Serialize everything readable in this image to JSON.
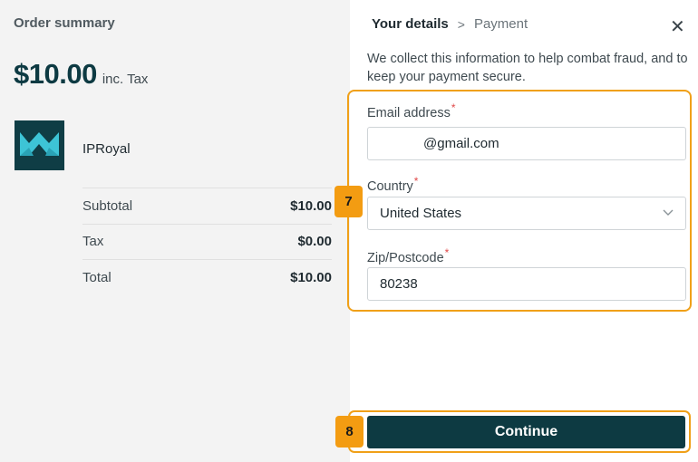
{
  "order": {
    "title": "Order summary",
    "price": "$10.00",
    "tax_note": "inc. Tax",
    "product_name": "IPRoyal",
    "logo_icon": "iproyal-crown-logo",
    "rows": [
      {
        "label": "Subtotal",
        "value": "$10.00"
      },
      {
        "label": "Tax",
        "value": "$0.00"
      },
      {
        "label": "Total",
        "value": "$10.00"
      }
    ]
  },
  "steps": {
    "current": "Your details",
    "separator": ">",
    "next": "Payment"
  },
  "close_icon": "close-icon",
  "info_text": "We collect this information to help combat fraud, and to keep your payment secure.",
  "form": {
    "email_label": "Email address",
    "email_value": "@gmail.com",
    "country_label": "Country",
    "country_value": "United States",
    "zip_label": "Zip/Postcode",
    "zip_value": "80238",
    "required_mark": "*"
  },
  "continue_label": "Continue",
  "annotations": {
    "badge_7": "7",
    "badge_8": "8"
  },
  "colors": {
    "brand": "#0d3a42",
    "highlight": "#f0a018",
    "required": "#e04848"
  }
}
